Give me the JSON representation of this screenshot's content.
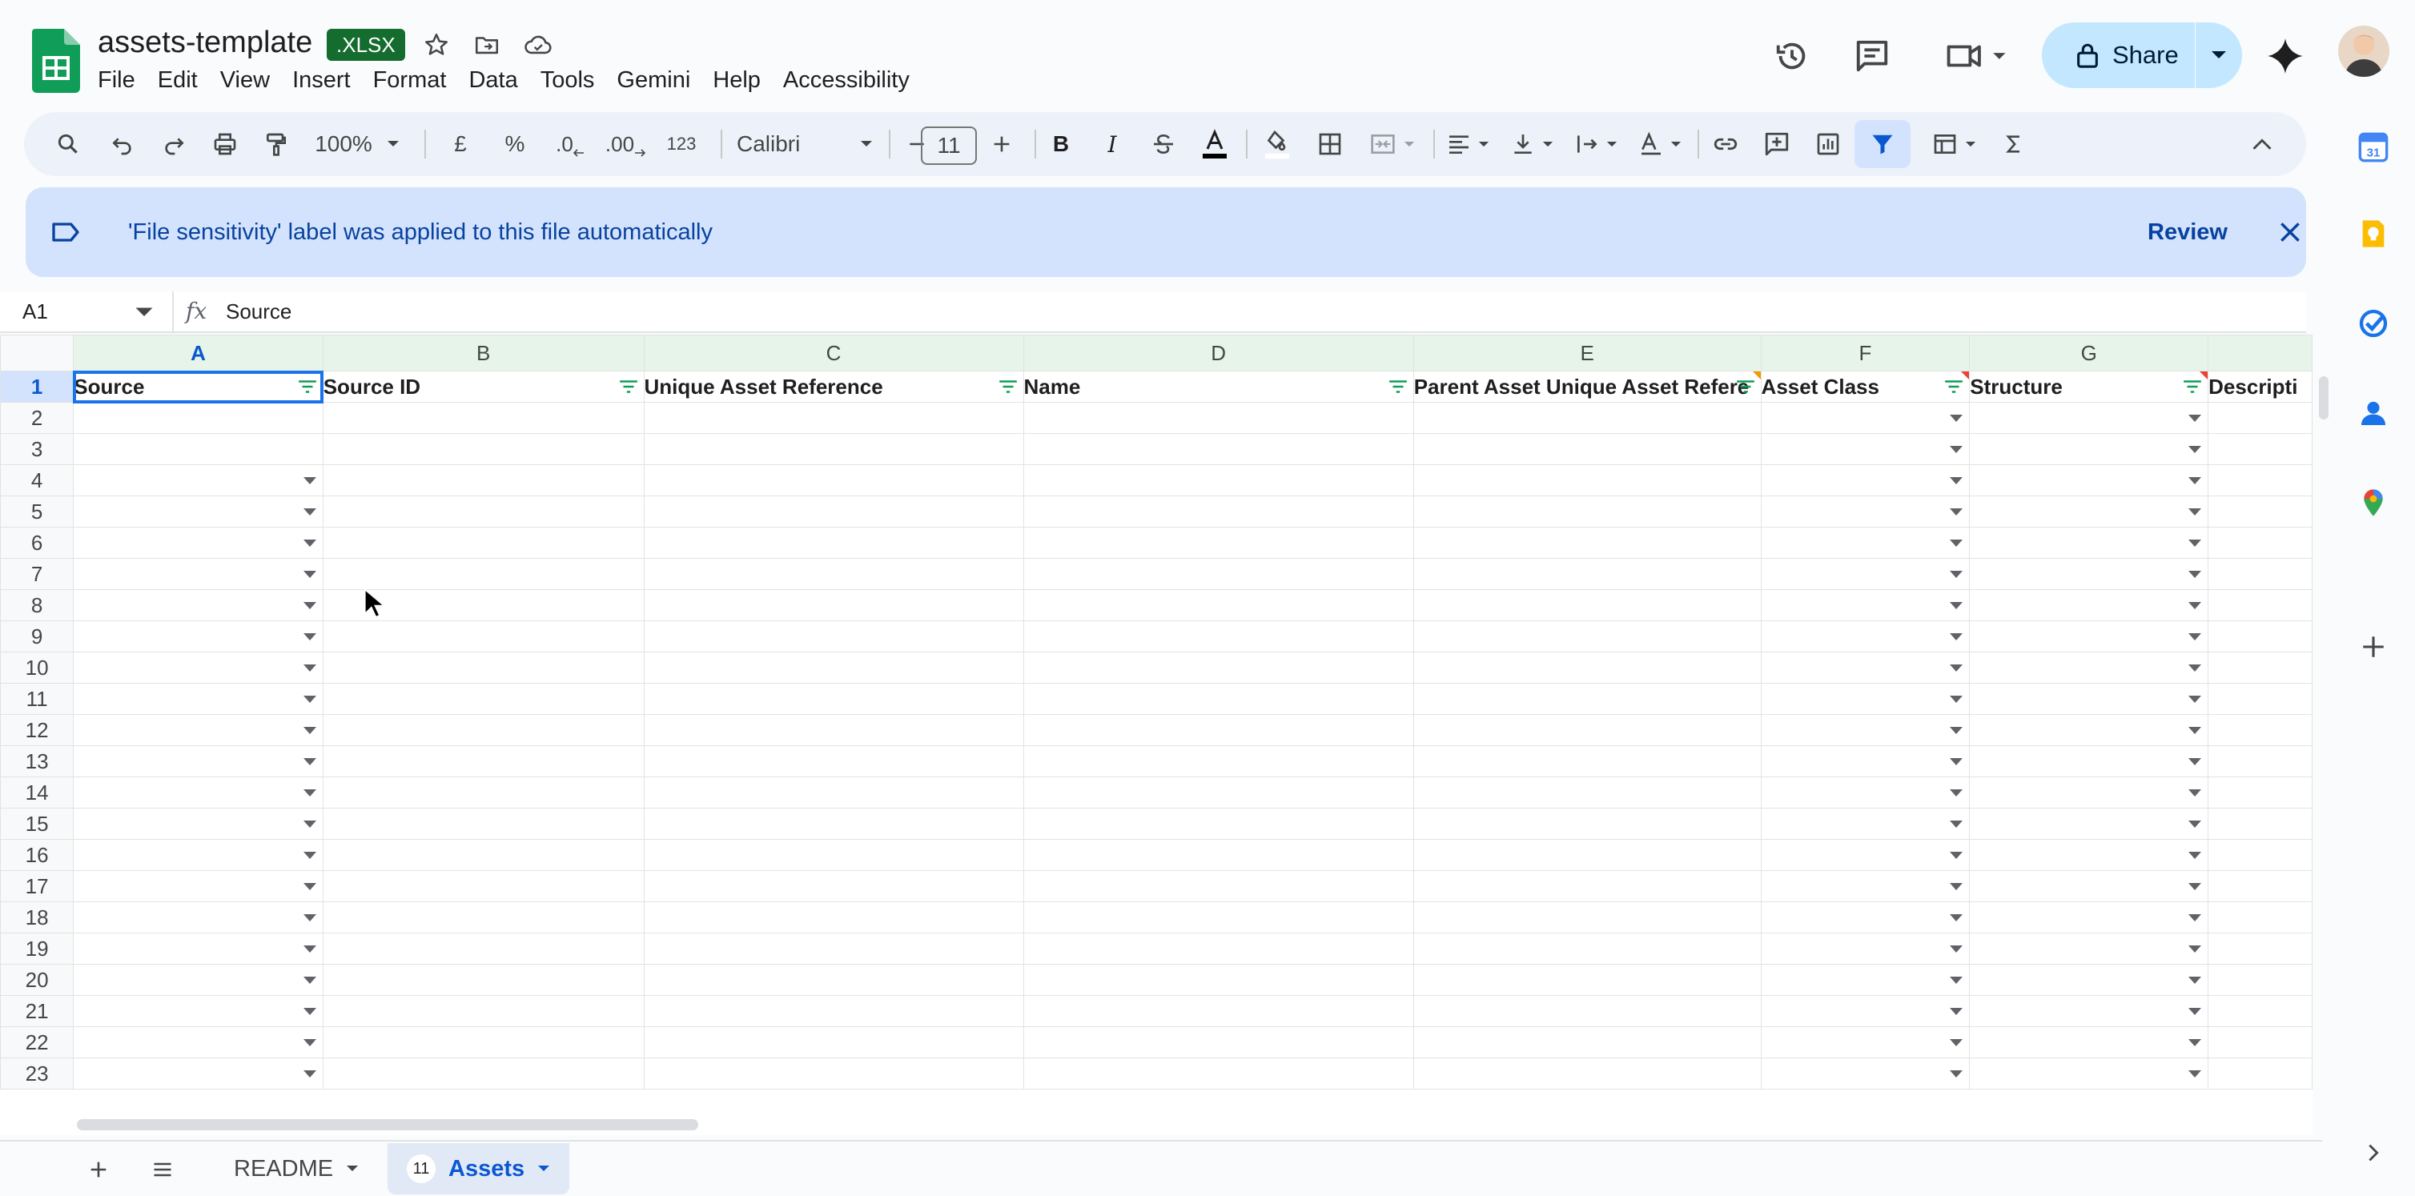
{
  "app": {
    "doc_title": "assets-template",
    "badge": ".XLSX",
    "menus": [
      "File",
      "Edit",
      "View",
      "Insert",
      "Format",
      "Data",
      "Tools",
      "Gemini",
      "Help",
      "Accessibility"
    ],
    "share_label": "Share"
  },
  "toolbar": {
    "zoom": "100%",
    "currency": "£",
    "percent": "%",
    "dec_less": ".0",
    "dec_more": ".00",
    "format_123": "123",
    "font": "Calibri",
    "font_size": "11",
    "bold": "B",
    "italic": "I"
  },
  "banner": {
    "text": "'File sensitivity' label was applied to this file automatically",
    "review": "Review"
  },
  "formula_bar": {
    "cell_ref": "A1",
    "fx": "fx",
    "value": "Source"
  },
  "grid": {
    "columns": [
      "A",
      "B",
      "C",
      "D",
      "E",
      "F",
      "G"
    ],
    "headers": [
      "Source",
      "Source ID",
      "Unique Asset Reference",
      "Name",
      "Parent Asset Unique Asset Refere",
      "Asset Class",
      "Structure",
      "Descripti"
    ],
    "row_numbers": [
      "1",
      "2",
      "3",
      "4",
      "5",
      "6",
      "7",
      "8",
      "9",
      "10",
      "11",
      "12",
      "13",
      "14",
      "15",
      "16",
      "17",
      "18",
      "19",
      "20",
      "21",
      "22",
      "23"
    ]
  },
  "sheets": {
    "tabs": [
      {
        "label": "README"
      },
      {
        "label": "Assets",
        "count": "11"
      }
    ]
  },
  "colors": {
    "accent": "#0b57d0",
    "share_bg": "#c2e7ff",
    "banner_bg": "#d3e3fd",
    "sheets_green": "#0f9d58"
  }
}
